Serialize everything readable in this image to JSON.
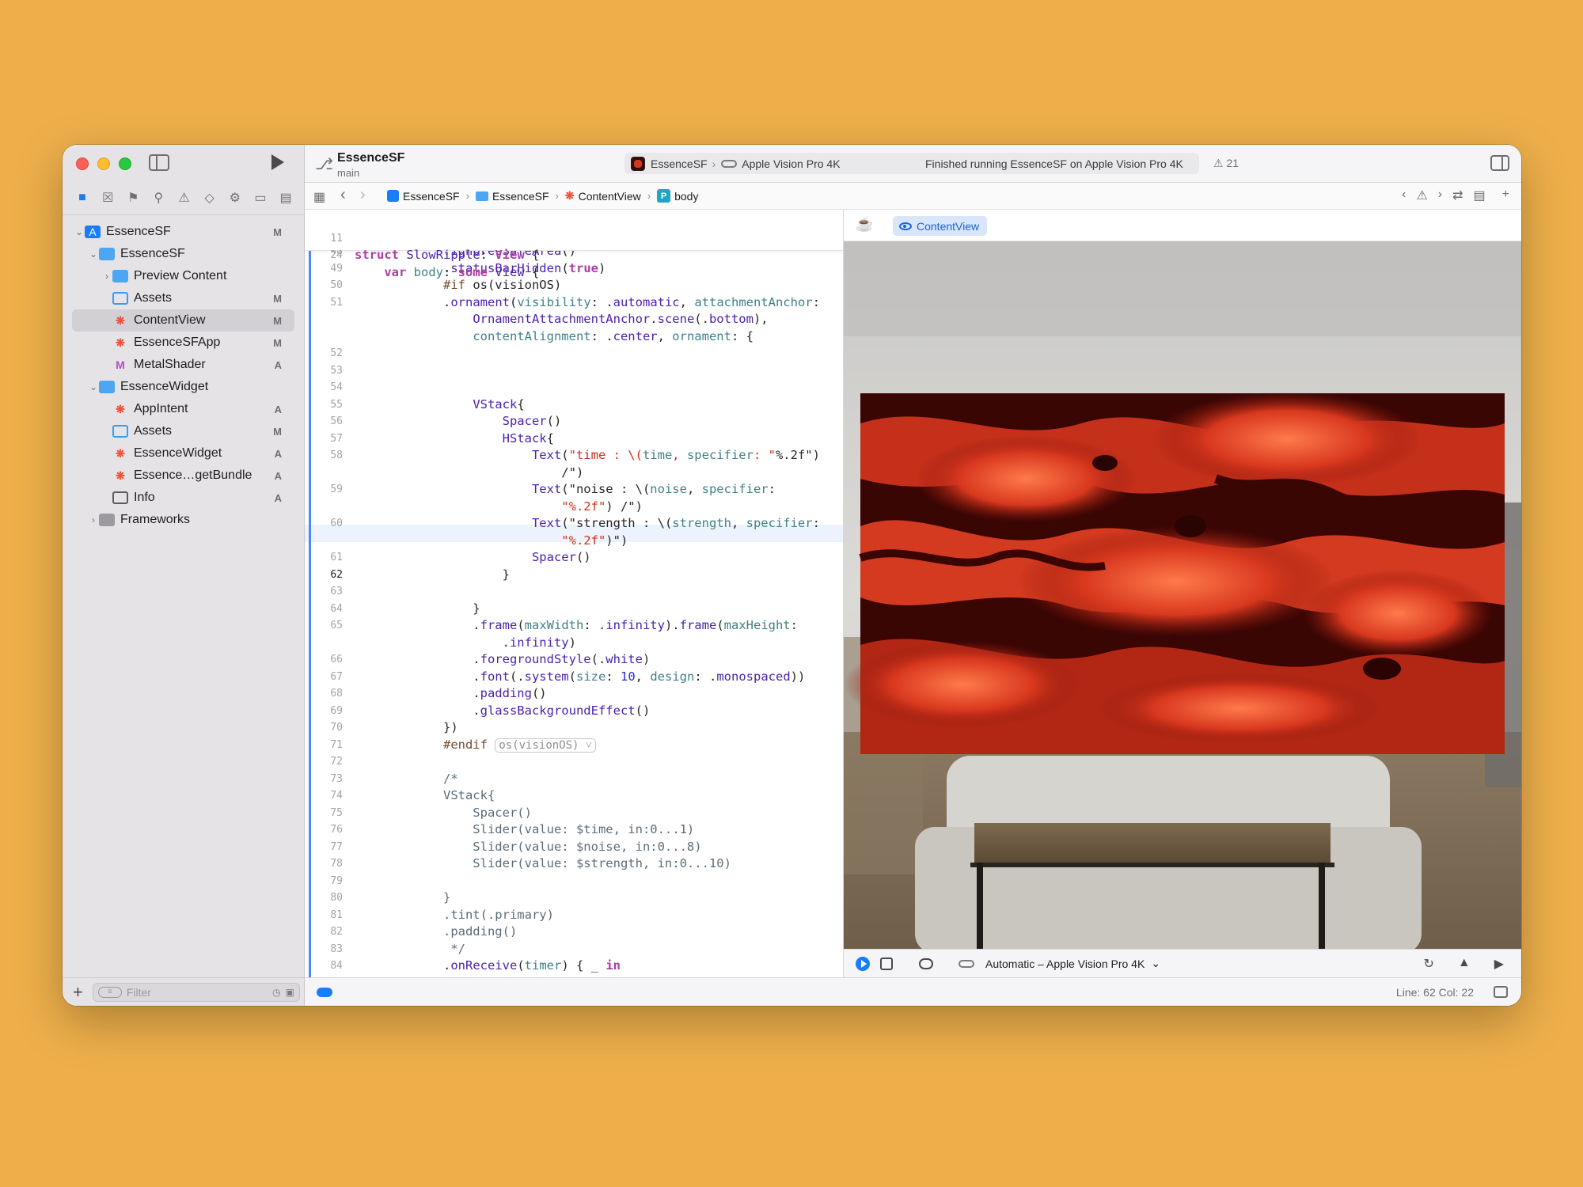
{
  "sidebar": {
    "items": [
      {
        "label": "EssenceSF",
        "badge": "M"
      },
      {
        "label": "EssenceSF",
        "badge": ""
      },
      {
        "label": "Preview Content",
        "badge": ""
      },
      {
        "label": "Assets",
        "badge": "M"
      },
      {
        "label": "ContentView",
        "badge": "M"
      },
      {
        "label": "EssenceSFApp",
        "badge": "M"
      },
      {
        "label": "MetalShader",
        "badge": "A"
      },
      {
        "label": "EssenceWidget",
        "badge": ""
      },
      {
        "label": "AppIntent",
        "badge": "A"
      },
      {
        "label": "Assets",
        "badge": "M"
      },
      {
        "label": "EssenceWidget",
        "badge": "A"
      },
      {
        "label": "Essence…getBundle",
        "badge": "A"
      },
      {
        "label": "Info",
        "badge": "A"
      },
      {
        "label": "Frameworks",
        "badge": ""
      }
    ],
    "filter_placeholder": "Filter"
  },
  "toolbar": {
    "project_name": "EssenceSF",
    "branch": "main",
    "scheme": "EssenceSF",
    "destination": "Apple Vision Pro 4K",
    "status": "Finished running EssenceSF on Apple Vision Pro 4K",
    "warnings": "21"
  },
  "jumpbar": {
    "crumbs": [
      "EssenceSF",
      "EssenceSF",
      "ContentView",
      "body"
    ]
  },
  "editor": {
    "sticky_lines": [
      {
        "n": "11",
        "text": "struct SlowRipple: View {"
      },
      {
        "n": "24",
        "text": "    var body: some View {"
      }
    ],
    "lines": [
      {
        "n": "48",
        "text": "            .ignoresSafeArea()"
      },
      {
        "n": "49",
        "text": "            .statusBarHidden(true)"
      },
      {
        "n": "50",
        "text": "            #if os(visionOS)"
      },
      {
        "n": "51",
        "text": "            .ornament(visibility: .automatic, attachmentAnchor:"
      },
      {
        "n": "",
        "text": "                OrnamentAttachmentAnchor.scene(.bottom),"
      },
      {
        "n": "",
        "text": "                contentAlignment: .center, ornament: {"
      },
      {
        "n": "52",
        "text": ""
      },
      {
        "n": "53",
        "text": ""
      },
      {
        "n": "54",
        "text": ""
      },
      {
        "n": "55",
        "text": "                VStack{"
      },
      {
        "n": "56",
        "text": "                    Spacer()"
      },
      {
        "n": "57",
        "text": "                    HStack{"
      },
      {
        "n": "58",
        "text": "                        Text(\"time : \\(time, specifier: \"%.2f\")"
      },
      {
        "n": "",
        "text": "                            /\")"
      },
      {
        "n": "59",
        "text": "                        Text(\"noise : \\(noise, specifier:"
      },
      {
        "n": "",
        "text": "                            \"%.2f\") /\")"
      },
      {
        "n": "60",
        "text": "                        Text(\"strength : \\(strength, specifier:"
      },
      {
        "n": "",
        "text": "                            \"%.2f\")\")"
      },
      {
        "n": "61",
        "text": "                        Spacer()"
      },
      {
        "n": "62",
        "text": "                    }"
      },
      {
        "n": "63",
        "text": ""
      },
      {
        "n": "64",
        "text": "                }"
      },
      {
        "n": "65",
        "text": "                .frame(maxWidth: .infinity).frame(maxHeight:"
      },
      {
        "n": "",
        "text": "                    .infinity)"
      },
      {
        "n": "66",
        "text": "                .foregroundStyle(.white)"
      },
      {
        "n": "67",
        "text": "                .font(.system(size: 10, design: .monospaced))"
      },
      {
        "n": "68",
        "text": "                .padding()"
      },
      {
        "n": "69",
        "text": "                .glassBackgroundEffect()"
      },
      {
        "n": "70",
        "text": "            })"
      },
      {
        "n": "71",
        "text": "            #endif"
      },
      {
        "n": "72",
        "text": ""
      },
      {
        "n": "73",
        "text": "            /*"
      },
      {
        "n": "74",
        "text": "            VStack{"
      },
      {
        "n": "75",
        "text": "                Spacer()"
      },
      {
        "n": "76",
        "text": "                Slider(value: $time, in:0...1)"
      },
      {
        "n": "77",
        "text": "                Slider(value: $noise, in:0...8)"
      },
      {
        "n": "78",
        "text": "                Slider(value: $strength, in:0...10)"
      },
      {
        "n": "79",
        "text": ""
      },
      {
        "n": "80",
        "text": "            }"
      },
      {
        "n": "81",
        "text": "            .tint(.primary)"
      },
      {
        "n": "82",
        "text": "            .padding()"
      },
      {
        "n": "83",
        "text": "             */"
      },
      {
        "n": "84",
        "text": "            .onReceive(timer) { _ in"
      }
    ],
    "fold_label": "os(visionOS)",
    "current_line": "62"
  },
  "preview": {
    "tab_label": "ContentView",
    "device_label": "Automatic – Apple Vision Pro 4K"
  },
  "statusbar": {
    "position": "Line: 62  Col: 22"
  },
  "colors": {
    "background": "#EEAF4A",
    "accent": "#1A7CF7",
    "lava_dark": "#3A0604",
    "lava_bright": "#E8482A"
  },
  "icons": [
    "folder-icon",
    "source-control-icon",
    "bookmark-icon",
    "search-icon",
    "warning-icon",
    "test-icon",
    "debug-icon",
    "breakpoint-icon",
    "report-icon"
  ]
}
